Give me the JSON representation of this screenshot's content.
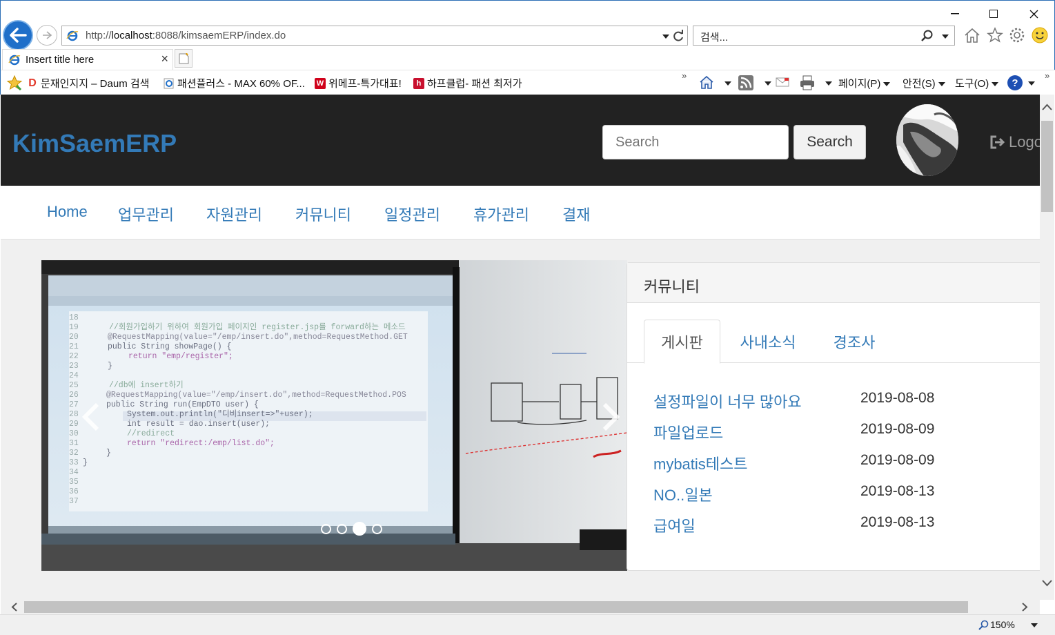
{
  "browser": {
    "url_prefix": "http://",
    "url_host": "localhost",
    "url_rest": ":8088/kimsaemERP/index.do",
    "search_placeholder": "검색...",
    "tab_title": "Insert title here",
    "favorites": [
      {
        "label": "문재인지지 – Daum 검색",
        "icon": "daum-icon"
      },
      {
        "label": "패션플러스 - MAX 60% OF...",
        "icon": "ie-page-icon"
      },
      {
        "label": "위메프-특가대표!",
        "icon": "wemakeprice-icon"
      },
      {
        "label": "하프클럽- 패션 최저가",
        "icon": "halfclub-icon"
      }
    ],
    "commands": {
      "page": "페이지(P)",
      "safety": "안전(S)",
      "tools": "도구(O)"
    },
    "zoom": "150%"
  },
  "header": {
    "brand": "KimSaemERP",
    "search_placeholder": "Search",
    "search_button": "Search",
    "logout": "Logo"
  },
  "menu": {
    "items": [
      "Home",
      "업무관리",
      "자원관리",
      "커뮤니티",
      "일정관리",
      "휴가관리",
      "결재"
    ]
  },
  "carousel": {
    "slide_count": 4,
    "active_index": 2
  },
  "community": {
    "title": "커뮤니티",
    "tabs": [
      "게시판",
      "사내소식",
      "경조사"
    ],
    "active_tab": 0,
    "posts": [
      {
        "title": "설정파일이 너무 많아요",
        "date": "2019-08-08"
      },
      {
        "title": "파일업로드",
        "date": "2019-08-09"
      },
      {
        "title": "mybatis테스트",
        "date": "2019-08-09"
      },
      {
        "title": "NO..일본",
        "date": "2019-08-13"
      },
      {
        "title": "급여일",
        "date": "2019-08-13"
      }
    ]
  },
  "colors": {
    "navbar": "#222222",
    "link": "#337ab7",
    "browser_accent": "#1f6fc9"
  }
}
